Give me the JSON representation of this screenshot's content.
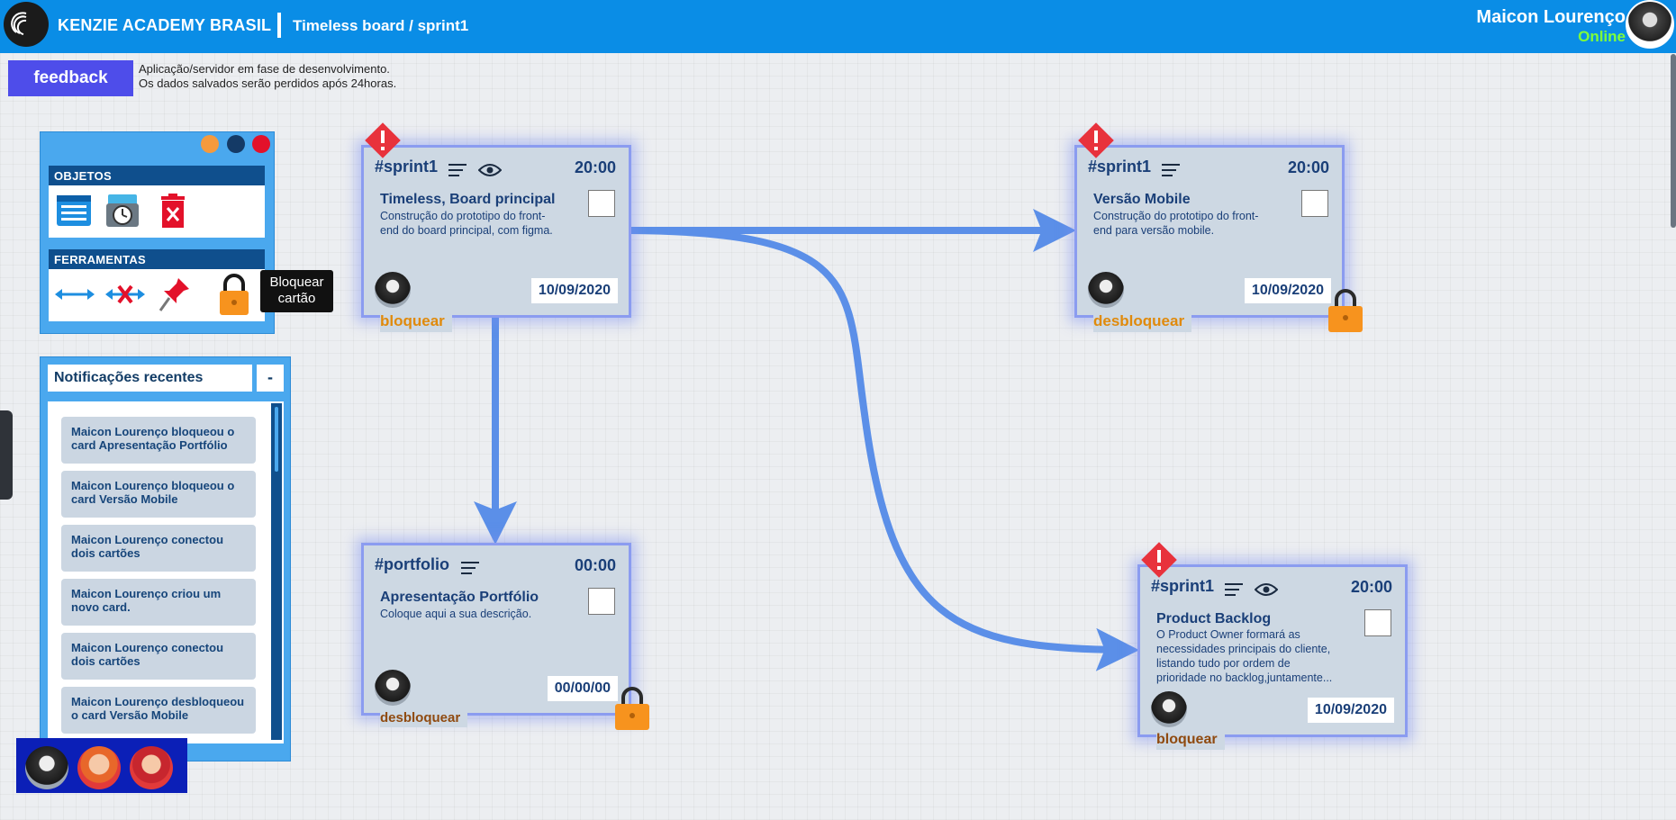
{
  "header": {
    "brand": "KENZIE ACADEMY BRASIL",
    "breadcrumb": "Timeless board / sprint1",
    "user_name": "Maicon Lourenço",
    "user_status": "Online"
  },
  "feedback": {
    "button_label": "feedback",
    "note_line1": "Aplicação/servidor em fase de desenvolvimento.",
    "note_line2": "Os dados salvados serão perdidos após 24horas."
  },
  "toolbox": {
    "objects_label": "OBJETOS",
    "tools_label": "FERRAMENTAS",
    "objects": [
      "card-icon",
      "clock-card-icon",
      "delete-card-icon"
    ],
    "tools": [
      "connect-arrow-icon",
      "disconnect-arrow-icon",
      "pin-icon",
      "lock-icon"
    ],
    "tooltip_line1": "Bloquear",
    "tooltip_line2": "cartão"
  },
  "notifications": {
    "title": "Notificações recentes",
    "minimize_label": "-",
    "items": [
      {
        "line1": "Maicon Lourenço bloqueou o",
        "line2": "card Apresentação Portfólio"
      },
      {
        "line1": "Maicon Lourenço bloqueou o",
        "line2": "card Versão Mobile"
      },
      {
        "line1": "Maicon Lourenço conectou",
        "line2": "dois cartões"
      },
      {
        "line1": "Maicon Lourenço criou um",
        "line2": "novo card."
      },
      {
        "line1": "Maicon Lourenço conectou",
        "line2": "dois cartões"
      },
      {
        "line1": "Maicon Lourenço desbloqueou",
        "line2": "o card Versão Mobile"
      }
    ]
  },
  "cards": [
    {
      "tag": "#sprint1",
      "time": "20:00",
      "title": "Timeless, Board principal",
      "desc_line1": "Construção do prototipo do front-",
      "desc_line2": "end do board principal, com figma.",
      "desc_line3": "",
      "desc_line4": "",
      "date": "10/09/2020",
      "action": "bloquear",
      "locked": false,
      "watched": true
    },
    {
      "tag": "#sprint1",
      "time": "20:00",
      "title": "Versão Mobile",
      "desc_line1": "Construção do prototipo do front-",
      "desc_line2": "end para versão mobile.",
      "desc_line3": "",
      "desc_line4": "",
      "date": "10/09/2020",
      "action": "desbloquear",
      "locked": true,
      "watched": false
    },
    {
      "tag": "#portfolio",
      "time": "00:00",
      "title": "Apresentação Portfólio",
      "desc_line1": "Coloque aqui a sua descrição.",
      "desc_line2": "",
      "desc_line3": "",
      "desc_line4": "",
      "date": "00/00/00",
      "action": "desbloquear",
      "locked": true,
      "watched": false
    },
    {
      "tag": "#sprint1",
      "time": "20:00",
      "title": "Product Backlog",
      "desc_line1": "O Product Owner formará as",
      "desc_line2": "necessidades principais do cliente,",
      "desc_line3": "listando tudo por ordem de",
      "desc_line4": "prioridade no backlog,juntamente...",
      "date": "10/09/2020",
      "action": "bloquear",
      "locked": false,
      "watched": true
    }
  ],
  "colors": {
    "header": "#0a8de6",
    "connector": "#5b8fe8",
    "warning": "#e8323c",
    "lock": "#f7931e",
    "online": "#7fff3a"
  }
}
